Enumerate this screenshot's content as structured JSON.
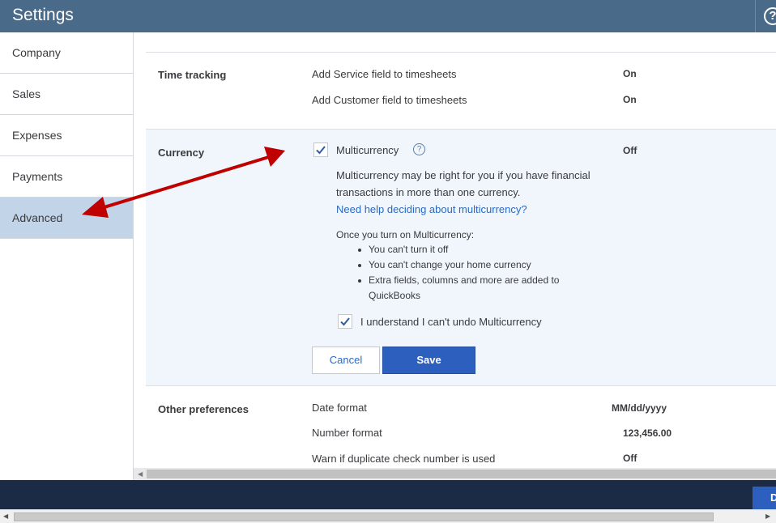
{
  "header": {
    "title": "Settings",
    "help_icon": "question-circle-icon",
    "help_glyph": "?"
  },
  "sidebar": {
    "items": [
      {
        "label": "Company",
        "active": false
      },
      {
        "label": "Sales",
        "active": false
      },
      {
        "label": "Expenses",
        "active": false
      },
      {
        "label": "Payments",
        "active": false
      },
      {
        "label": "Advanced",
        "active": true
      }
    ]
  },
  "time_tracking": {
    "section_label": "Time tracking",
    "rows": [
      {
        "label": "Add Service field to timesheets",
        "value": "On"
      },
      {
        "label": "Add Customer field to timesheets",
        "value": "On"
      }
    ]
  },
  "currency": {
    "section_label": "Currency",
    "multicurrency_label": "Multicurrency",
    "multicurrency_checked": true,
    "multicurrency_value": "Off",
    "info_line1": "Multicurrency may be right for you if you have financial",
    "info_line2": "transactions in more than one currency.",
    "help_link": "Need help deciding about multicurrency?",
    "once_title": "Once you turn on Multicurrency:",
    "bullets": [
      "You can't turn it off",
      "You can't change your home currency",
      "Extra fields, columns and more are added to",
      "QuickBooks"
    ],
    "understand_label": "I understand I can't undo Multicurrency",
    "understand_checked": true,
    "cancel_label": "Cancel",
    "save_label": "Save"
  },
  "other_preferences": {
    "section_label": "Other preferences",
    "rows": [
      {
        "label": "Date format",
        "value": "MM/dd/yyyy"
      },
      {
        "label": "Number format",
        "value": "123,456.00"
      },
      {
        "label": "Warn if duplicate check number is used",
        "value": "Off"
      }
    ]
  },
  "bottom_bar": {
    "done_label": "Done"
  },
  "colors": {
    "header_bg": "#4a6a8a",
    "active_sidebar": "#c2d4e8",
    "currency_bg": "#f0f6fc",
    "link": "#2b6ac2",
    "save_button": "#2d5fbf",
    "bottom_bar": "#1b2b45",
    "annotation_arrow": "#c00000"
  }
}
